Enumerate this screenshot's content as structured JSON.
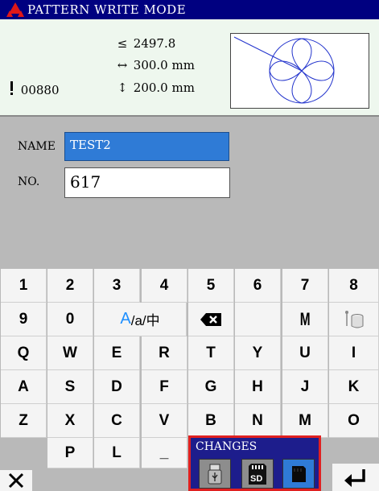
{
  "header": {
    "title": "PATTERN WRITE MODE"
  },
  "stats": {
    "stitch_count": "2497.8",
    "width": "300.0 mm",
    "height": "200.0 mm",
    "pattern_number": "00880"
  },
  "form": {
    "name_label": "NAME",
    "name_value": "TEST2",
    "no_label": "NO.",
    "no_value": "617"
  },
  "keyboard": {
    "row1": [
      "1",
      "2",
      "3",
      "4",
      "5",
      "6",
      "7",
      "8"
    ],
    "row2_digits": [
      "9",
      "0"
    ],
    "mode_a": "A",
    "mode_rest": "/a/中",
    "row2_m": "M",
    "row3": [
      "Q",
      "W",
      "E",
      "R",
      "T",
      "Y",
      "U",
      "I"
    ],
    "row4": [
      "A",
      "S",
      "D",
      "F",
      "G",
      "H",
      "J",
      "K"
    ],
    "row5": [
      "Z",
      "X",
      "C",
      "V",
      "B",
      "N",
      "M",
      "O"
    ],
    "row6": [
      "P",
      "L",
      "_"
    ]
  },
  "footer": {
    "changes_label": "CHANGES"
  },
  "colors": {
    "title_bar": "#000080",
    "selected_field": "#2f7bd6",
    "changes_border": "#e02020",
    "mode_accent": "#1e8fff"
  }
}
